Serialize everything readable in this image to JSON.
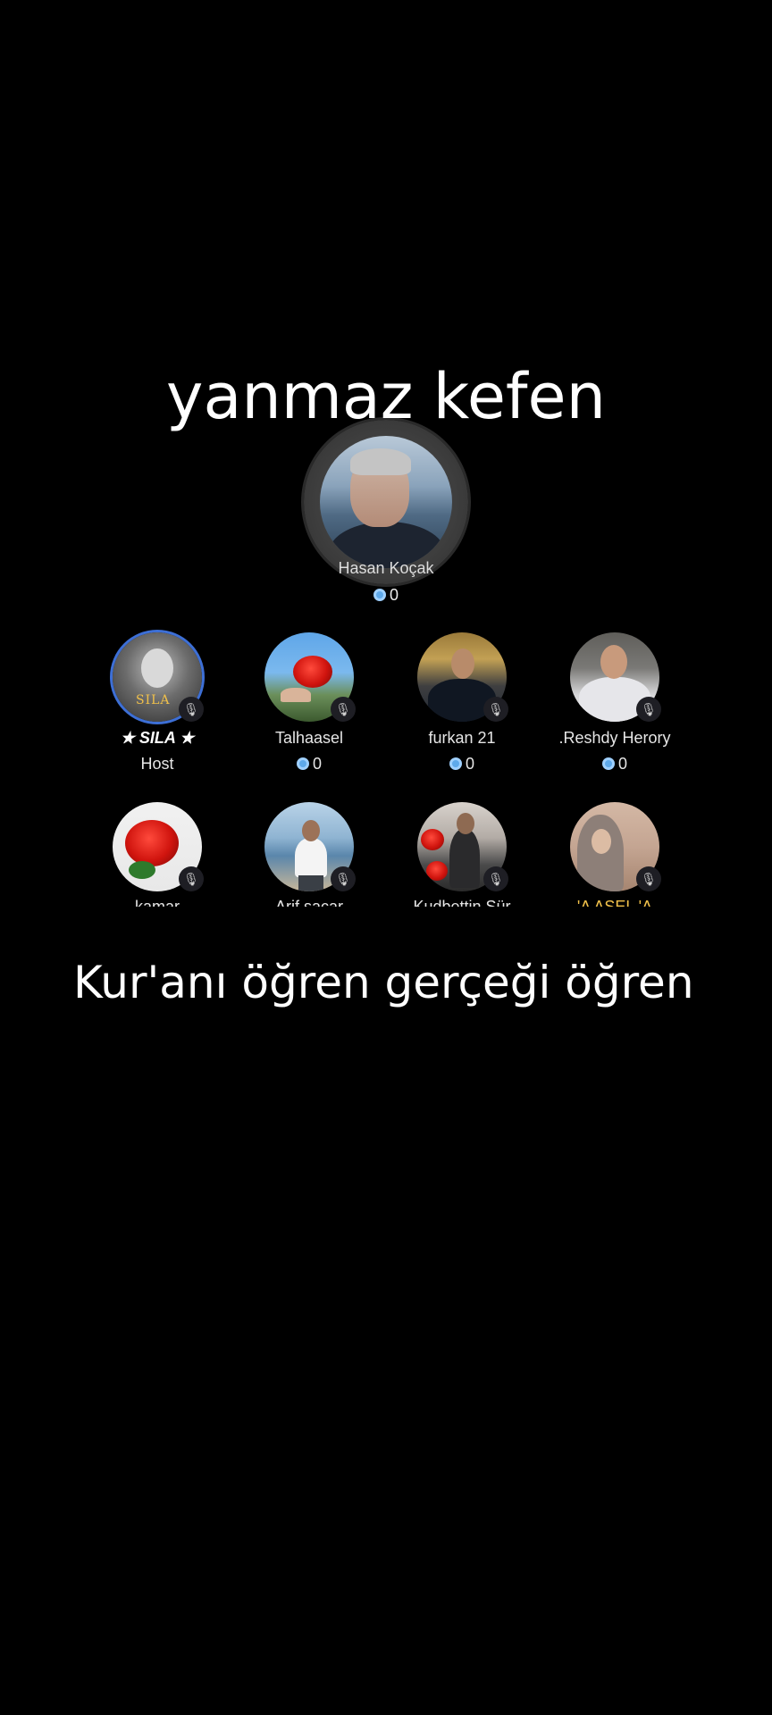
{
  "overlay": {
    "title": "yanmaz kefen",
    "bottom_text": "Kur'anı öğren gerçeği öğren"
  },
  "speaker": {
    "name": "Hasan Koçak",
    "count": "0"
  },
  "seats": [
    {
      "name": "★ SILA ★",
      "sub": "Host",
      "badge_text": "SILA"
    },
    {
      "name": "Talhaasel",
      "count": "0"
    },
    {
      "name": "furkan 21",
      "count": "0"
    },
    {
      "name": ".Reshdy Herory",
      "count": "0"
    },
    {
      "name": "kamar"
    },
    {
      "name": "Arif sacar"
    },
    {
      "name": "Kudbettin Sür"
    },
    {
      "name": "'A ASEL 'A"
    }
  ],
  "icons": {
    "mic_off": "mic-off-icon",
    "coin": "coin-icon"
  },
  "colors": {
    "background": "#000000",
    "coin": "#5ea9ea",
    "host_ring": "#3d6fd6",
    "sila_badge": "#f0c04a"
  }
}
